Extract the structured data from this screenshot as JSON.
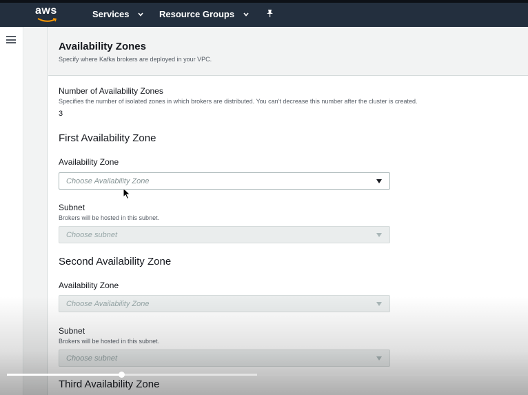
{
  "topnav": {
    "logo_text": "aws",
    "services_label": "Services",
    "resource_groups_label": "Resource Groups",
    "pin_icon": "pin-icon"
  },
  "section": {
    "title": "Availability Zones",
    "description": "Specify where Kafka brokers are deployed in your VPC."
  },
  "az_count": {
    "label": "Number of Availability Zones",
    "help": "Specifies the number of isolated zones in which brokers are distributed. You can't decrease this number after the cluster is created.",
    "value": "3"
  },
  "zones": [
    {
      "heading": "First Availability Zone",
      "az_label": "Availability Zone",
      "az_placeholder": "Choose Availability Zone",
      "subnet_label": "Subnet",
      "subnet_help": "Brokers will be hosted in this subnet.",
      "subnet_placeholder": "Choose subnet"
    },
    {
      "heading": "Second Availability Zone",
      "az_label": "Availability Zone",
      "az_placeholder": "Choose Availability Zone",
      "subnet_label": "Subnet",
      "subnet_help": "Brokers will be hosted in this subnet.",
      "subnet_placeholder": "Choose subnet"
    },
    {
      "heading": "Third Availability Zone"
    }
  ],
  "video": {
    "played_fraction": 0.22,
    "buffered_fraction": 0.48
  },
  "colors": {
    "nav_bg": "#232f3e",
    "brand_orange": "#ff9900"
  }
}
